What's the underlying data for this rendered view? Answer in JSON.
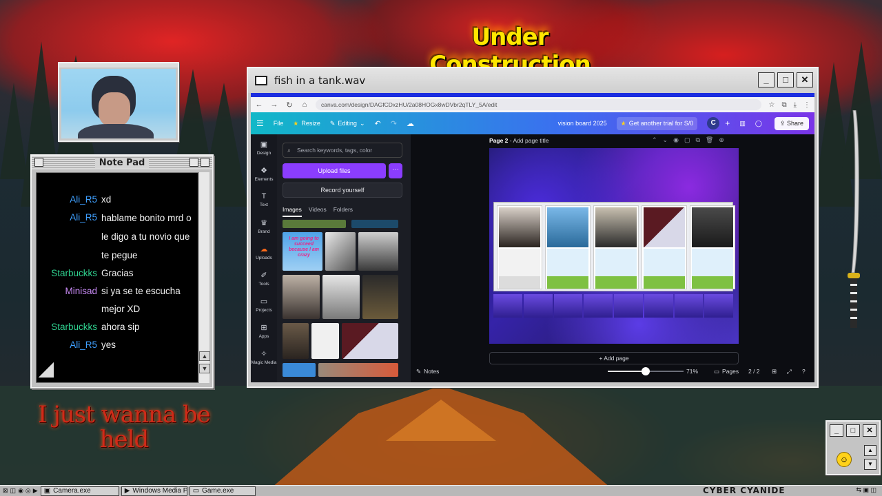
{
  "desktop": {
    "banner": "Under Construction",
    "decor_text": "I just wanna be held"
  },
  "notepad": {
    "title": "Note Pad",
    "messages": [
      {
        "user": "Ali_R5",
        "text": "xd",
        "color": "#3fa0ff"
      },
      {
        "user": "Ali_R5",
        "text": "hablame bonito mrd o le digo a tu novio que te pegue",
        "color": "#3fa0ff"
      },
      {
        "user": "Starbuckks",
        "text": "Gracias",
        "color": "#2fd18f"
      },
      {
        "user": "Minisad",
        "text": "si ya se te escucha mejor XD",
        "color": "#c88af5"
      },
      {
        "user": "Starbuckks",
        "text": "ahora sip",
        "color": "#2fd18f"
      },
      {
        "user": "Ali_R5",
        "text": "yes",
        "color": "#3fa0ff"
      }
    ]
  },
  "main_window": {
    "title": "fish in a tank.wav",
    "url": "canva.com/design/DAGfCDxzHU/2a08HOGx8wDVbr2qTLY_5A/edit",
    "canva": {
      "menu_file": "File",
      "menu_resize": "Resize",
      "menu_editing": "Editing",
      "design_title": "vision board 2025",
      "trial": "Get another trial for S/0",
      "avatar": "C",
      "share": "Share",
      "rail": [
        {
          "label": "Design",
          "icon": "design-icon"
        },
        {
          "label": "Elements",
          "icon": "elements-icon"
        },
        {
          "label": "Text",
          "icon": "text-icon"
        },
        {
          "label": "Brand",
          "icon": "brand-icon"
        },
        {
          "label": "Uploads",
          "icon": "upload-icon"
        },
        {
          "label": "Tools",
          "icon": "tools-icon"
        },
        {
          "label": "Projects",
          "icon": "folder-icon"
        },
        {
          "label": "Apps",
          "icon": "apps-icon"
        },
        {
          "label": "Magic Media",
          "icon": "magic-media-icon"
        }
      ],
      "search_placeholder": "Search keywords, tags, color",
      "upload_files": "Upload files",
      "record_yourself": "Record yourself",
      "tabs": [
        "Images",
        "Videos",
        "Folders"
      ],
      "thumb_quote": "I am going to succeed because I am crazy",
      "page_title": "Page 2",
      "add_page_title": "- Add page title",
      "add_page": "+ Add page",
      "notes": "Notes",
      "zoom_value": 71,
      "zoom_label": "71%",
      "pages": "Pages",
      "page_count": "2 / 2"
    }
  },
  "taskbar": {
    "tasks": [
      "Camera.exe",
      "Windows Media Pla",
      "Game.exe"
    ],
    "brand": "CYBER CYANIDE"
  }
}
